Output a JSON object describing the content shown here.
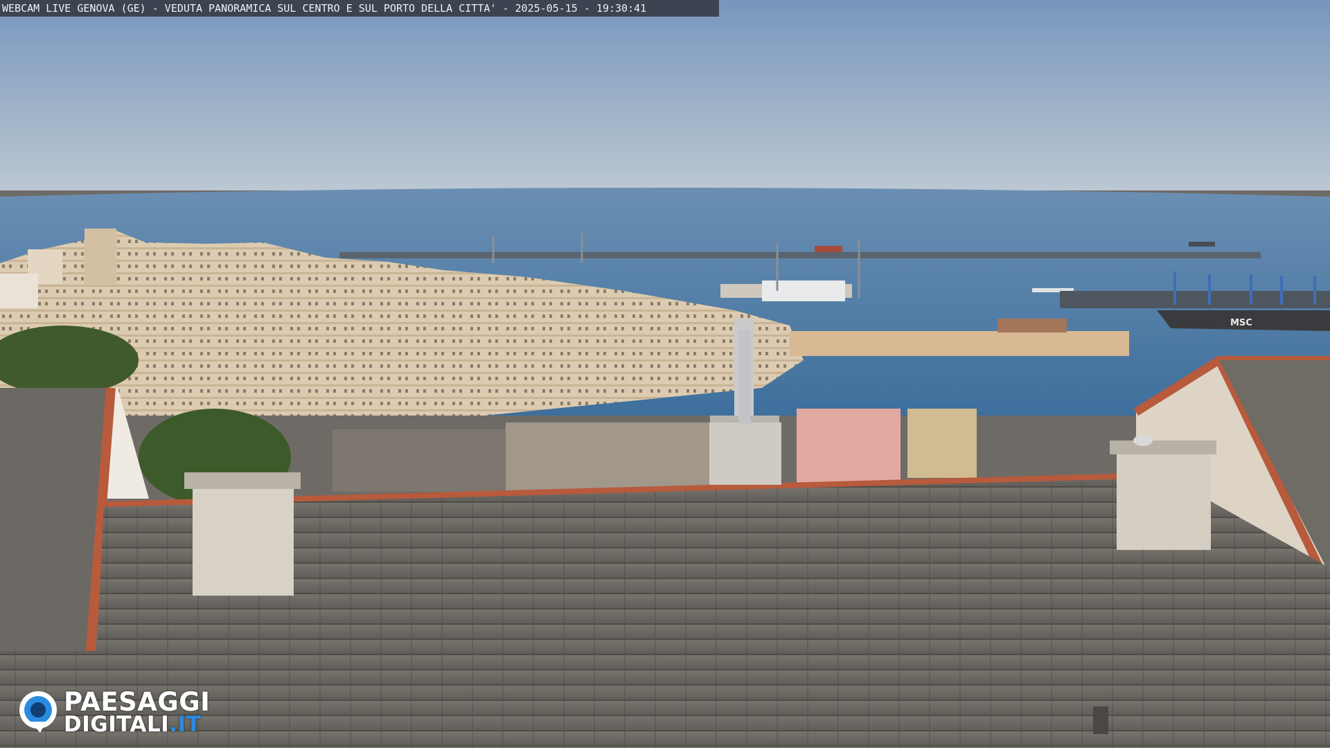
{
  "overlay": {
    "title": "WEBCAM LIVE GENOVA (GE) - VEDUTA PANORAMICA SUL CENTRO E SUL PORTO DELLA CITTA' - 2025-05-15 - 19:30:41"
  },
  "logo": {
    "line1": "PAESAGGI",
    "line2_main": "DIGITALI",
    "line2_accent": ".IT",
    "accent_color": "#2b8be0"
  },
  "ship_marking": "MSC",
  "colors": {
    "sky_top": "#7e9cc0",
    "sky_horizon": "#b8c6d4",
    "sea": "#4f7ea8",
    "roof": "#6f6c67",
    "roof_tile_edge": "#b85a3c",
    "city": "#d9c7a8"
  }
}
